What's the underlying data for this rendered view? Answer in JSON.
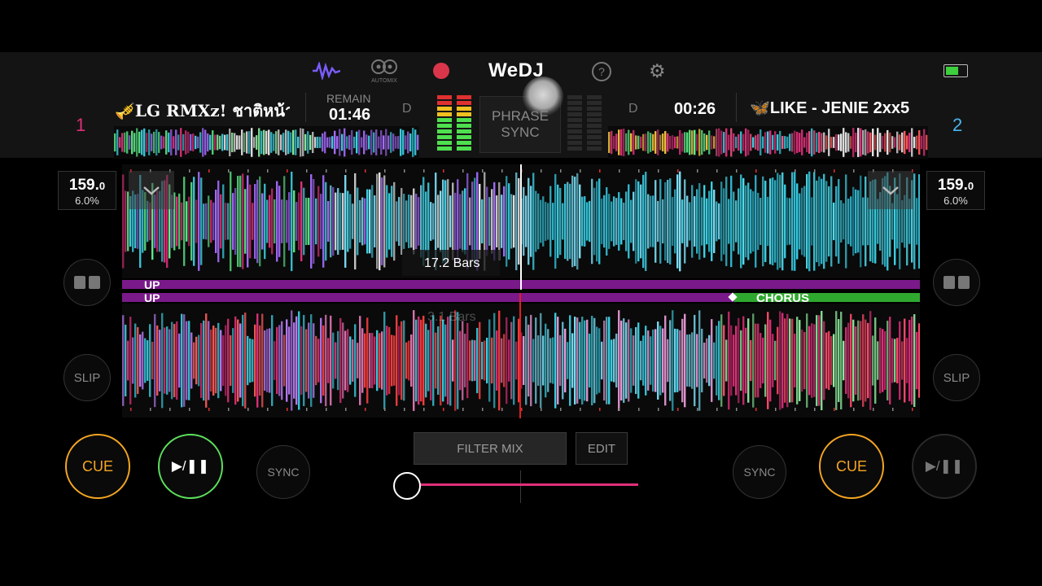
{
  "topbar": {
    "logo": "WeDJ",
    "automix_label": "AUTOMIX",
    "icons": [
      "waveform-icon",
      "automix-icon",
      "record-icon",
      "help-icon",
      "gear-icon",
      "battery-icon"
    ]
  },
  "deck1": {
    "number": "1",
    "title": "🎺LG RMXz! ชาติหน้า",
    "remain_label": "REMAIN",
    "time": "01:46",
    "d_label": "D",
    "bpm": "159.",
    "bpm_decimal": "0",
    "pitch": "6.0%",
    "bars_label": "17.2 Bars",
    "phrase_label": "UP",
    "cue_label": "CUE",
    "sync_label": "SYNC",
    "slip_label": "SLIP",
    "play_label": "▶/❚❚",
    "color": "#e0307a"
  },
  "deck2": {
    "number": "2",
    "title": "🦋LIKE - JENIE 2xx5",
    "time": "00:26",
    "d_label": "D",
    "bpm": "159.",
    "bpm_decimal": "0",
    "pitch": "6.0%",
    "bars_label": "3.1 Bars",
    "phrase_label": "UP",
    "phrase_label_2": "CHORUS",
    "cue_label": "CUE",
    "sync_label": "SYNC",
    "slip_label": "SLIP",
    "play_label": "▶/❚❚",
    "color": "#4ab4f0"
  },
  "center": {
    "phrase_sync_line1": "PHRASE",
    "phrase_sync_line2": "SYNC",
    "filter_mix_label": "FILTER MIX",
    "edit_label": "EDIT",
    "crossfader_position": 0
  },
  "colors": {
    "cue_orange": "#f5a623",
    "play_green": "#5de05d",
    "accent_pink": "#e0307a",
    "phrase_purple": "#7a1a8a",
    "chorus_green": "#2fa82f"
  }
}
